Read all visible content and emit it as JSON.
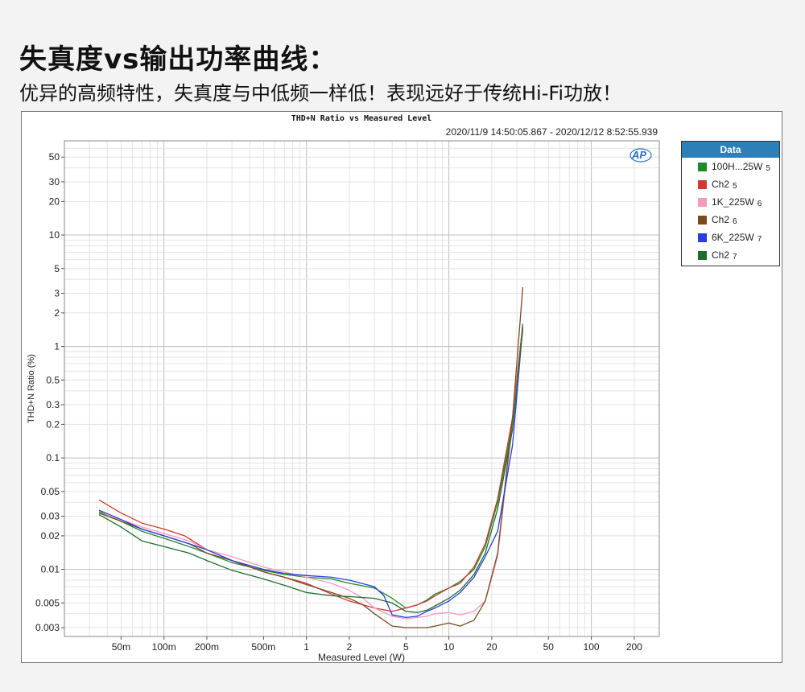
{
  "header": {
    "title": "失真度vs输出功率曲线：",
    "subtitle": "优异的高频特性，失真度与中低频一样低！表现远好于传统Hi-Fi功放！"
  },
  "chart_data": {
    "type": "line",
    "title": "THD+N Ratio vs Measured Level",
    "subtitle": "2020/11/9 14:50:05.867 - 2020/12/12 8:52:55.939",
    "xlabel": "Measured Level (W)",
    "ylabel": "THD+N Ratio (%)",
    "x_scale": "log",
    "y_scale": "log",
    "xlim": [
      0.02,
      300
    ],
    "ylim": [
      0.0025,
      70
    ],
    "x_ticks": [
      {
        "v": 0.05,
        "label": "50m"
      },
      {
        "v": 0.1,
        "label": "100m"
      },
      {
        "v": 0.2,
        "label": "200m"
      },
      {
        "v": 0.5,
        "label": "500m"
      },
      {
        "v": 1,
        "label": "1"
      },
      {
        "v": 2,
        "label": "2"
      },
      {
        "v": 5,
        "label": "5"
      },
      {
        "v": 10,
        "label": "10"
      },
      {
        "v": 20,
        "label": "20"
      },
      {
        "v": 50,
        "label": "50"
      },
      {
        "v": 100,
        "label": "100"
      },
      {
        "v": 200,
        "label": "200"
      }
    ],
    "y_ticks": [
      {
        "v": 0.003,
        "label": "0.003"
      },
      {
        "v": 0.005,
        "label": "0.005"
      },
      {
        "v": 0.01,
        "label": "0.01"
      },
      {
        "v": 0.02,
        "label": "0.02"
      },
      {
        "v": 0.03,
        "label": "0.03"
      },
      {
        "v": 0.05,
        "label": "0.05"
      },
      {
        "v": 0.1,
        "label": "0.1"
      },
      {
        "v": 0.2,
        "label": "0.2"
      },
      {
        "v": 0.3,
        "label": "0.3"
      },
      {
        "v": 0.5,
        "label": "0.5"
      },
      {
        "v": 1,
        "label": "1"
      },
      {
        "v": 2,
        "label": "2"
      },
      {
        "v": 3,
        "label": "3"
      },
      {
        "v": 5,
        "label": "5"
      },
      {
        "v": 10,
        "label": "10"
      },
      {
        "v": 20,
        "label": "20"
      },
      {
        "v": 30,
        "label": "30"
      },
      {
        "v": 50,
        "label": "50"
      }
    ],
    "grid": true,
    "legend_title": "Data",
    "legend_position": "right",
    "logo": "AP",
    "series": [
      {
        "name": "100H...25W",
        "index": "5",
        "color": "#1f8a2a",
        "x": [
          0.035,
          0.05,
          0.07,
          0.1,
          0.15,
          0.2,
          0.3,
          0.5,
          0.7,
          1,
          1.5,
          2,
          3,
          4,
          5,
          6,
          7,
          8,
          10,
          12,
          15,
          18,
          22,
          28,
          33
        ],
        "y": [
          0.033,
          0.027,
          0.022,
          0.019,
          0.016,
          0.014,
          0.0115,
          0.0098,
          0.009,
          0.0085,
          0.0082,
          0.0075,
          0.0068,
          0.0055,
          0.0045,
          0.0048,
          0.0053,
          0.006,
          0.0068,
          0.0078,
          0.01,
          0.016,
          0.04,
          0.2,
          1.6
        ]
      },
      {
        "name": "Ch2",
        "index": "5",
        "color": "#d03a33",
        "x": [
          0.035,
          0.05,
          0.07,
          0.1,
          0.14,
          0.2,
          0.3,
          0.5,
          0.7,
          1,
          1.5,
          2,
          2.5,
          3,
          4,
          5,
          6,
          7,
          8,
          10,
          12,
          15,
          18,
          22,
          28,
          33
        ],
        "y": [
          0.042,
          0.032,
          0.026,
          0.023,
          0.02,
          0.015,
          0.012,
          0.0095,
          0.0085,
          0.0075,
          0.006,
          0.0052,
          0.0048,
          0.0045,
          0.0042,
          0.0045,
          0.0048,
          0.0052,
          0.0058,
          0.0068,
          0.0075,
          0.0105,
          0.017,
          0.043,
          0.23,
          1.55
        ]
      },
      {
        "name": "1K_225W",
        "index": "6",
        "color": "#f49ac1",
        "x": [
          0.035,
          0.05,
          0.07,
          0.1,
          0.15,
          0.2,
          0.3,
          0.5,
          0.7,
          1,
          1.5,
          2,
          2.5,
          3,
          4,
          5,
          6,
          7,
          8,
          10,
          12,
          15,
          18,
          22,
          28,
          33
        ],
        "y": [
          0.032,
          0.028,
          0.024,
          0.021,
          0.018,
          0.015,
          0.013,
          0.0105,
          0.0095,
          0.0085,
          0.0075,
          0.0065,
          0.0055,
          0.0045,
          0.0038,
          0.0036,
          0.0037,
          0.0038,
          0.004,
          0.0041,
          0.0039,
          0.0042,
          0.0052,
          0.013,
          0.2,
          1.4
        ]
      },
      {
        "name": "Ch2",
        "index": "6",
        "color": "#7a4a1e",
        "x": [
          0.035,
          0.05,
          0.07,
          0.1,
          0.15,
          0.2,
          0.3,
          0.5,
          0.7,
          1,
          1.5,
          2,
          2.5,
          3,
          4,
          5,
          6,
          7,
          8,
          10,
          12,
          15,
          18,
          22,
          28,
          33
        ],
        "y": [
          0.032,
          0.027,
          0.023,
          0.02,
          0.017,
          0.014,
          0.012,
          0.0095,
          0.0085,
          0.0073,
          0.0062,
          0.0055,
          0.0048,
          0.004,
          0.0031,
          0.003,
          0.003,
          0.003,
          0.0031,
          0.0033,
          0.0031,
          0.0035,
          0.0052,
          0.014,
          0.23,
          3.4
        ]
      },
      {
        "name": "6K_225W",
        "index": "7",
        "color": "#2a3de0",
        "x": [
          0.035,
          0.05,
          0.07,
          0.1,
          0.15,
          0.2,
          0.3,
          0.5,
          0.7,
          1,
          1.5,
          2,
          3,
          3.5,
          4,
          4.5,
          5,
          6,
          7,
          8,
          10,
          12,
          15,
          18,
          22,
          28,
          33
        ],
        "y": [
          0.034,
          0.028,
          0.023,
          0.02,
          0.017,
          0.015,
          0.012,
          0.01,
          0.0092,
          0.0088,
          0.0085,
          0.008,
          0.007,
          0.0058,
          0.0039,
          0.0038,
          0.0037,
          0.0038,
          0.0042,
          0.0045,
          0.0052,
          0.0062,
          0.0085,
          0.013,
          0.022,
          0.13,
          1.5
        ]
      },
      {
        "name": "Ch2",
        "index": "7",
        "color": "#1d6e2c",
        "x": [
          0.035,
          0.05,
          0.07,
          0.1,
          0.15,
          0.2,
          0.3,
          0.5,
          0.7,
          1,
          1.5,
          2,
          3,
          4,
          5,
          6,
          7,
          8,
          10,
          12,
          15,
          18,
          22,
          28,
          33
        ],
        "y": [
          0.031,
          0.024,
          0.018,
          0.016,
          0.014,
          0.012,
          0.0098,
          0.0082,
          0.0072,
          0.0062,
          0.0058,
          0.0057,
          0.0055,
          0.005,
          0.0042,
          0.0041,
          0.0043,
          0.0047,
          0.0055,
          0.0065,
          0.009,
          0.014,
          0.035,
          0.18,
          1.45
        ]
      }
    ]
  }
}
